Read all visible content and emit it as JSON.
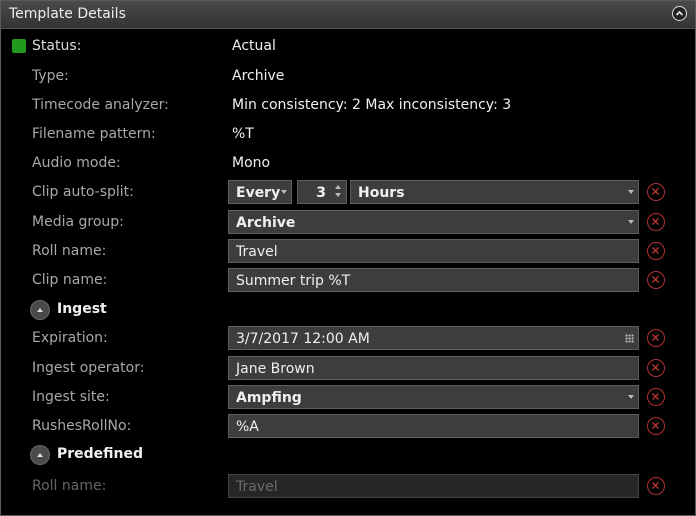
{
  "panel": {
    "title": "Template Details",
    "collapse_icon": "chevron-up-icon"
  },
  "status": {
    "label": "Status:",
    "value": "Actual",
    "color": "#1f9a1f"
  },
  "type": {
    "label": "Type:",
    "value": "Archive"
  },
  "timecode": {
    "label": "Timecode analyzer:",
    "value": "Min consistency: 2 Max inconsistency: 3"
  },
  "filename": {
    "label": "Filename pattern:",
    "value": "%T"
  },
  "audio": {
    "label": "Audio mode:",
    "value": "Mono"
  },
  "clip_split": {
    "label": "Clip auto-split:",
    "mode": "Every",
    "count": "3",
    "unit": "Hours"
  },
  "media_group": {
    "label": "Media group:",
    "value": "Archive"
  },
  "roll_name": {
    "label": "Roll name:",
    "value": "Travel"
  },
  "clip_name": {
    "label": "Clip name:",
    "value": "Summer trip %T"
  },
  "ingest": {
    "title": "Ingest",
    "expiration": {
      "label": "Expiration:",
      "value": "3/7/2017 12:00 AM"
    },
    "operator": {
      "label": "Ingest operator:",
      "value": "Jane Brown"
    },
    "site": {
      "label": "Ingest site:",
      "value": "Ampfing"
    },
    "rushes": {
      "label": "RushesRollNo:",
      "value": "%A"
    }
  },
  "predefined": {
    "title": "Predefined",
    "roll_name": {
      "label": "Roll name:",
      "value": "Travel"
    }
  },
  "clear_icon": "close-icon",
  "clear_color": "#b03232"
}
